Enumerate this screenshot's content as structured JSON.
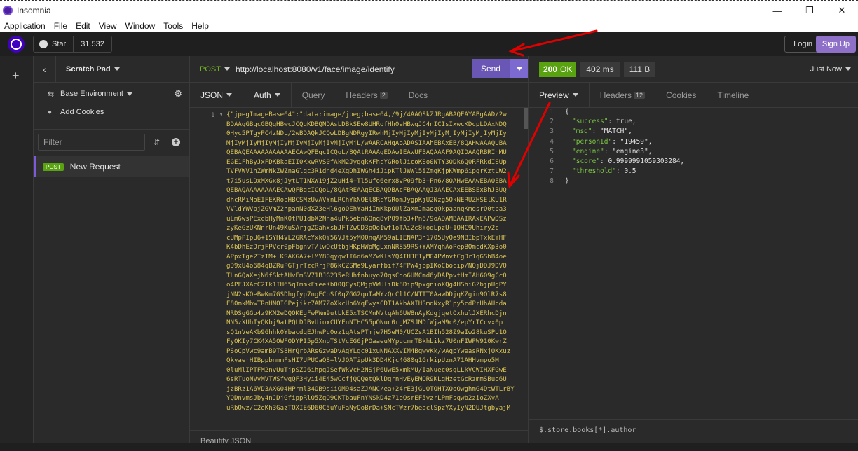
{
  "window": {
    "title": "Insomnia"
  },
  "menu": [
    "Application",
    "File",
    "Edit",
    "View",
    "Window",
    "Tools",
    "Help"
  ],
  "header": {
    "star_label": "Star",
    "star_count": "31.532",
    "login": "Login",
    "signup": "Sign Up"
  },
  "sidebar": {
    "scratch_pad": "Scratch Pad",
    "environment": "Base Environment",
    "cookies": "Add Cookies",
    "filter_placeholder": "Filter",
    "requests": [
      {
        "method": "POST",
        "name": "New Request"
      }
    ]
  },
  "request": {
    "method": "POST",
    "url": "http://localhost:8080/v1/face/image/identify",
    "send": "Send",
    "tabs": {
      "body": "JSON",
      "auth": "Auth",
      "query": "Query",
      "headers": "Headers",
      "headers_count": "2",
      "docs": "Docs"
    },
    "body_lines": [
      "{\"jpegImageBase64\":\"data:image/jpeg;base64,/9j/4AAQSkZJRgABAQEAYABgAAD/2w",
      "BDAAgGBgcGBQgHBwcJCQgKDBQNDAsLDBkSEw8UHRofHh0aHBwgJC4nICIsIxwcKDcpLDAxNDQ",
      "0Hyc5PTgyPC4zNDL/2wBDAQkJCQwLDBgNDRgyIRwhMjIyMjIyMjIyMjIyMjIyMjIyMjIyMjIy",
      "MjIyMjIyMjIyMjIyMjIyMjIyMjIyMjIyMjL/wAARCAHgAoADASIAAhEBAxEB/8QAHwAAAQUBA",
      "QEBAQEAAAAAAAAAAAECAwQFBgcICQoL/8QAtRAAAgEDAwIEAwUFBAQAAAF9AQIDAAQRBRIhMU",
      "EGE1FhByJxFDKBkaEII0KxwRVS0fAkM2JyggkKFhcYGRolJicoKSo0NTY3ODk6Q0RFRkdISUp",
      "TVFVWV1hZWmNkZWZnaGlqc3R1dnd4eXqDhIWGh4iJipKTlJWWl5iZmqKjpKWmp6ipqrKztLW2",
      "t7i5usLDxMXGx8jJytLT1NXW19jZ2uHi4+Tl5ufo6erx8vP09fb3+Pn6/8QAHwEAAwEBAQEBA",
      "QEBAQAAAAAAAAECAwQFBgcICQoL/8QAtREAAgECBAQDBAcFBAQAAQJ3AAECAxEEBSExBhJBUQ",
      "dhcRMiMoEIFEKRobHBCSMzUvAVYnLRChYkNOEl8RcYGRomJygpKjU2Nzg5OkNERUZHSElKU1R",
      "VVldYWVpjZGVmZ2hpanN0dXZ3eHl6goOEhYaHiImKkpOUlZaXmJmaoqOkpaanqKmqsrO0tba3",
      "uLm6wsPExcbHyMnK0tPU1dbX2Nna4uPk5ebn6Onq8vP09fb3+Pn6/9oADAMBAAIRAxEAPwDSz",
      "zyKeGzUKNnrUn49KuSArjgZGahxsbJFTZwCD3pQoIwf1oTAiZc8+oqLpzU+1QHC9Uhiry2c",
      "cUMpPIpU6+1SYH4VL2GRAcYxk0Y56VJt5yM00nqAM59aLIENAP3h1705UyOe9NBIbpTxkEYHF",
      "K4bDhEzDrjFPVcr0pFbgnvT/lwOcUtbjHKpHWpMgLxnNR859RS+YAMYqhAoPepBQmcdKXp3o0",
      "APpxTge2TzTM+lKSAKGA7+lMY80qyqwII6d6aMZwKlsYQ4IHJFIyMG4PWnvtCgDr1qGSbB4oe",
      "gD9xU4o684qBZRuPGTjrTzcRrjP86kCZSMe9Lyarfbif74FPW4jbpIKoCbocip/NQjDDJ9DVQ",
      "TLnGQaXejN6fSktAHvEmSV71BJG235eRUhfnbuyo70qsCdo6UMCmd6yDAPpvtHmIAH609gCc0",
      "o4PFJXAcC2Tk1IH65qImmkFieeKb00QCysQMjpVWUliDk8Dip9pxgnioXQg4HShiGZbjpUgPY",
      "jNN2sKOeBwKm7GSDhgfyp7ngECoSf0qZGG2quIaMYzQcCl1C/NTTT0AawDDjqKZgin9OlR7s8",
      "E80mkMbwTRnHNOIGPejikr7AM7ZoXkcUp6YqFwysCDT1AkbAXIHSmqNxyR1py5cdPrUhAUcda",
      "NRDSgGGo4z9KN2eDQOKEgFwPWm9utLkE5xTSCMnNVtqAh6UW8nAyKdgjqetOxhulJXERhcDjn",
      "NN5zXUhIyQKbj9atPQLDJBvUioxCUYEnNTHC55pONuc0rgMZSJMDfWjaM9c0/epYrTCcvx0p",
      "sQ1nVeAKb96hhk0YbacdqEJhwPc0oz1qAtsPTmje7H5eM0/UCZsA1BIh528Z9aIw28kuSPU1O",
      "FyOKIy7CK4XA5OWFODYPI5p5XnpTStVcEG6jPOaaeuMYpucmrTBkhbikz7U0nFIWPW910KwrZ",
      "PSoCpVwc9amB9TS8HrQrbARsGzwaDvAqYLgc01xuNNAXXvIM4BqwvKk/wAqpYweasRNxjOKxuz",
      "QkyaerHIBppbnmmFsHI7UPUCaQ8+lVJOATipUk3DD4Kjc4680g1GrkipUznA71AHHvmpo5M",
      "0luMlIPTFM2nvUuTjpSZJ6ihpgJSefWkVcH2NSjP6UwE5xmkMU/IaNuec0sgLLkVCWIHXFGwE",
      "6sRTuoNVvMVTWSfwqQF3Hyii4E45wCcfjQQQetQklDgrnHvEyEMOR9KLgHzetGcRzmmSBuo6U",
      "jzBRz1A6VD3AXG04HPrml34OB9siiQM94saZJANC/ea+24rE3jGUOTQHTXOoQwghmG4DtWTLrBY",
      "YQDnvmsJby4nJDjGfippRlO5ZgO9CKTbauFnYNSkD4z71eOsrEF5vzrLPmFsqwb2zioZXvA",
      "uRbOwz/C2eKh3GazTOXIE6D60C5uYuFaNyOoBrDa+SNcTWzr7beaclSpzYXyIyN2DUJtgbyajM"
    ],
    "beautify": "Beautify JSON"
  },
  "response": {
    "status_code": "200",
    "status_text": "OK",
    "time": "402 ms",
    "size": "111 B",
    "when": "Just Now",
    "tabs": {
      "preview": "Preview",
      "headers": "Headers",
      "headers_count": "12",
      "cookies": "Cookies",
      "timeline": "Timeline"
    },
    "lines": [
      {
        "n": "1",
        "key": "",
        "val": "{"
      },
      {
        "n": "2",
        "key": "\"success\"",
        "val": ": true,"
      },
      {
        "n": "3",
        "key": "\"msg\"",
        "val": ": \"MATCH\","
      },
      {
        "n": "4",
        "key": "\"personId\"",
        "val": ": \"19459\","
      },
      {
        "n": "5",
        "key": "\"engine\"",
        "val": ": \"engine3\","
      },
      {
        "n": "6",
        "key": "\"score\"",
        "val": ": 0.9999991059303284,"
      },
      {
        "n": "7",
        "key": "\"threshold\"",
        "val": ": 0.5"
      },
      {
        "n": "8",
        "key": "",
        "val": "}"
      }
    ],
    "jsonpath_placeholder": "$.store.books[*].author"
  },
  "annotation_color": "#e00000"
}
